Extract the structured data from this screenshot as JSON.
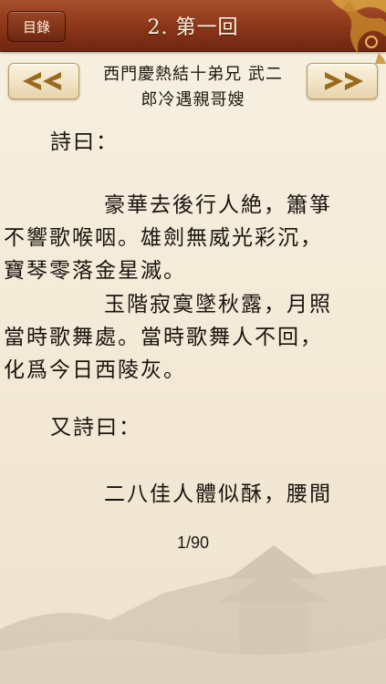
{
  "header": {
    "title": "2. 第一回",
    "menu_label": "目錄"
  },
  "chapter": {
    "title_line1": "西門慶熱結十弟兄 武二",
    "title_line2": "郎冷遇親哥嫂",
    "prev_icon": "double-chevron-left-icon",
    "next_icon": "double-chevron-right-icon"
  },
  "content": {
    "lines": [
      "詩曰：",
      "豪華去後行人絶，簫箏",
      "不響歌喉咽。雄劍無威光彩沉，",
      "寶琴零落金星滅。",
      "玉階寂寞墜秋露，月照",
      "當時歌舞處。當時歌舞人不回，",
      "化爲今日西陵灰。",
      "又詩曰：",
      "二八佳人體似酥，腰間"
    ]
  },
  "footer": {
    "page_indicator": "1/90"
  },
  "colors": {
    "topbar": "#8a3518",
    "nav_button": "#efe1c2",
    "arrow": "#9a6a1c",
    "paper": "#f5ecdb"
  }
}
